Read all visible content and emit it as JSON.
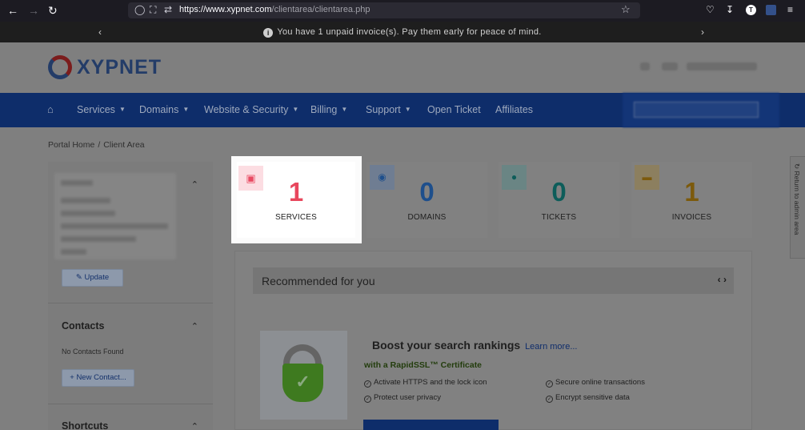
{
  "browser": {
    "url_domain": "https://www.xypnet.com",
    "url_path": "/clientarea/clientarea.php",
    "back_icon": "arrow-left-icon",
    "forward_icon": "arrow-right-icon",
    "reload_icon": "reload-icon",
    "profile_letter": "T"
  },
  "notice": {
    "text": "You have 1 unpaid invoice(s). Pay them early for peace of mind."
  },
  "header": {
    "logo_text": "XYPNET"
  },
  "nav": {
    "items": [
      {
        "label": "Services",
        "dropdown": true
      },
      {
        "label": "Domains",
        "dropdown": true
      },
      {
        "label": "Website & Security",
        "dropdown": true
      },
      {
        "label": "Billing",
        "dropdown": true
      },
      {
        "label": "Support",
        "dropdown": true
      },
      {
        "label": "Open Ticket",
        "dropdown": false
      },
      {
        "label": "Affiliates",
        "dropdown": false
      }
    ]
  },
  "breadcrumb": {
    "home": "Portal Home",
    "separator": "/",
    "current": "Client Area"
  },
  "sidebar": {
    "update_label": "Update",
    "contacts_title": "Contacts",
    "contacts_empty": "No Contacts Found",
    "new_contact_label": "New Contact...",
    "shortcuts_title": "Shortcuts"
  },
  "stats": [
    {
      "count": "1",
      "label": "SERVICES",
      "color": "#e8475d",
      "icon": "box-icon"
    },
    {
      "count": "0",
      "label": "DOMAINS",
      "color": "#1e4f8c",
      "icon": "globe-icon"
    },
    {
      "count": "0",
      "label": "TICKETS",
      "color": "#0d5d5a",
      "icon": "chat-icon"
    },
    {
      "count": "1",
      "label": "INVOICES",
      "color": "#7c5a0c",
      "icon": "credit-card-icon"
    }
  ],
  "recommended": {
    "title": "Recommended for you",
    "promo_title": "Boost your search rankings",
    "learn_more": "Learn more...",
    "subtitle": "with a RapidSSL™ Certificate",
    "features": [
      "Activate HTTPS and the lock icon",
      "Protect user privacy",
      "Secure online transactions",
      "Encrypt sensitive data"
    ]
  },
  "side_tab": {
    "label": "Return to admin area"
  }
}
